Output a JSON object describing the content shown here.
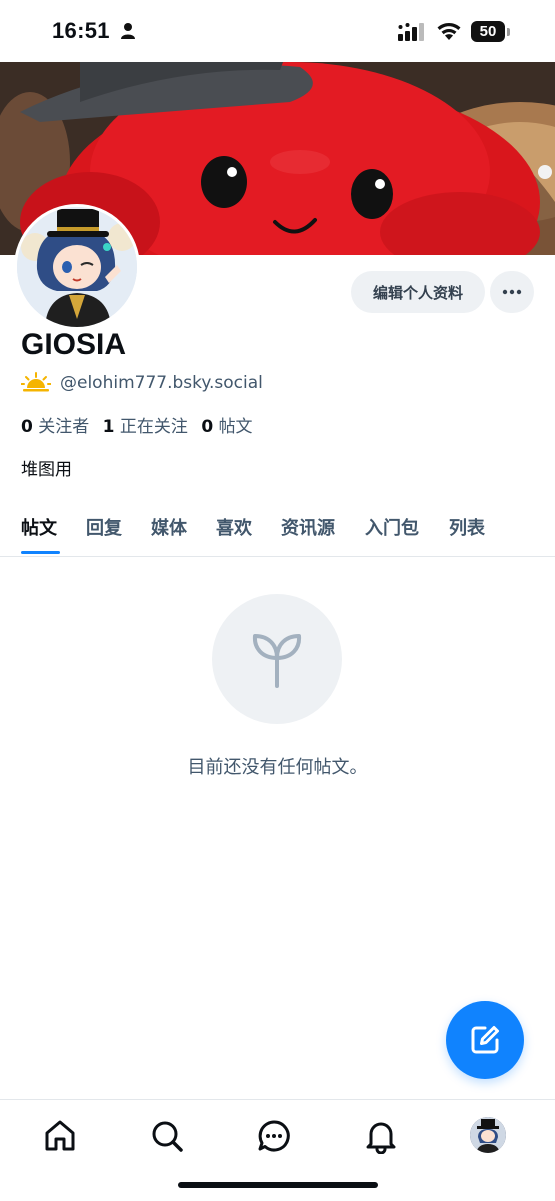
{
  "status_bar": {
    "time": "16:51",
    "battery": "50"
  },
  "profile": {
    "display_name": "GIOSIA",
    "handle": "@elohim777.bsky.social",
    "handle_emoji": "sunrise-emoji",
    "followers_count": "0",
    "followers_label": "关注者",
    "following_count": "1",
    "following_label": "正在关注",
    "posts_count": "0",
    "posts_label": "帖文",
    "bio": "堆图用",
    "edit_button": "编辑个人资料"
  },
  "tabs": [
    {
      "label": "帖文",
      "active": true
    },
    {
      "label": "回复",
      "active": false
    },
    {
      "label": "媒体",
      "active": false
    },
    {
      "label": "喜欢",
      "active": false
    },
    {
      "label": "资讯源",
      "active": false
    },
    {
      "label": "入门包",
      "active": false
    },
    {
      "label": "列表",
      "active": false
    }
  ],
  "empty_state": {
    "icon": "sprout-icon",
    "message": "目前还没有任何帖文。"
  },
  "bottom_nav": [
    "home-icon",
    "search-icon",
    "chat-icon",
    "bell-icon",
    "profile-avatar"
  ],
  "colors": {
    "accent": "#1083fe",
    "muted_text": "#42576c",
    "button_bg": "#eef1f4"
  }
}
